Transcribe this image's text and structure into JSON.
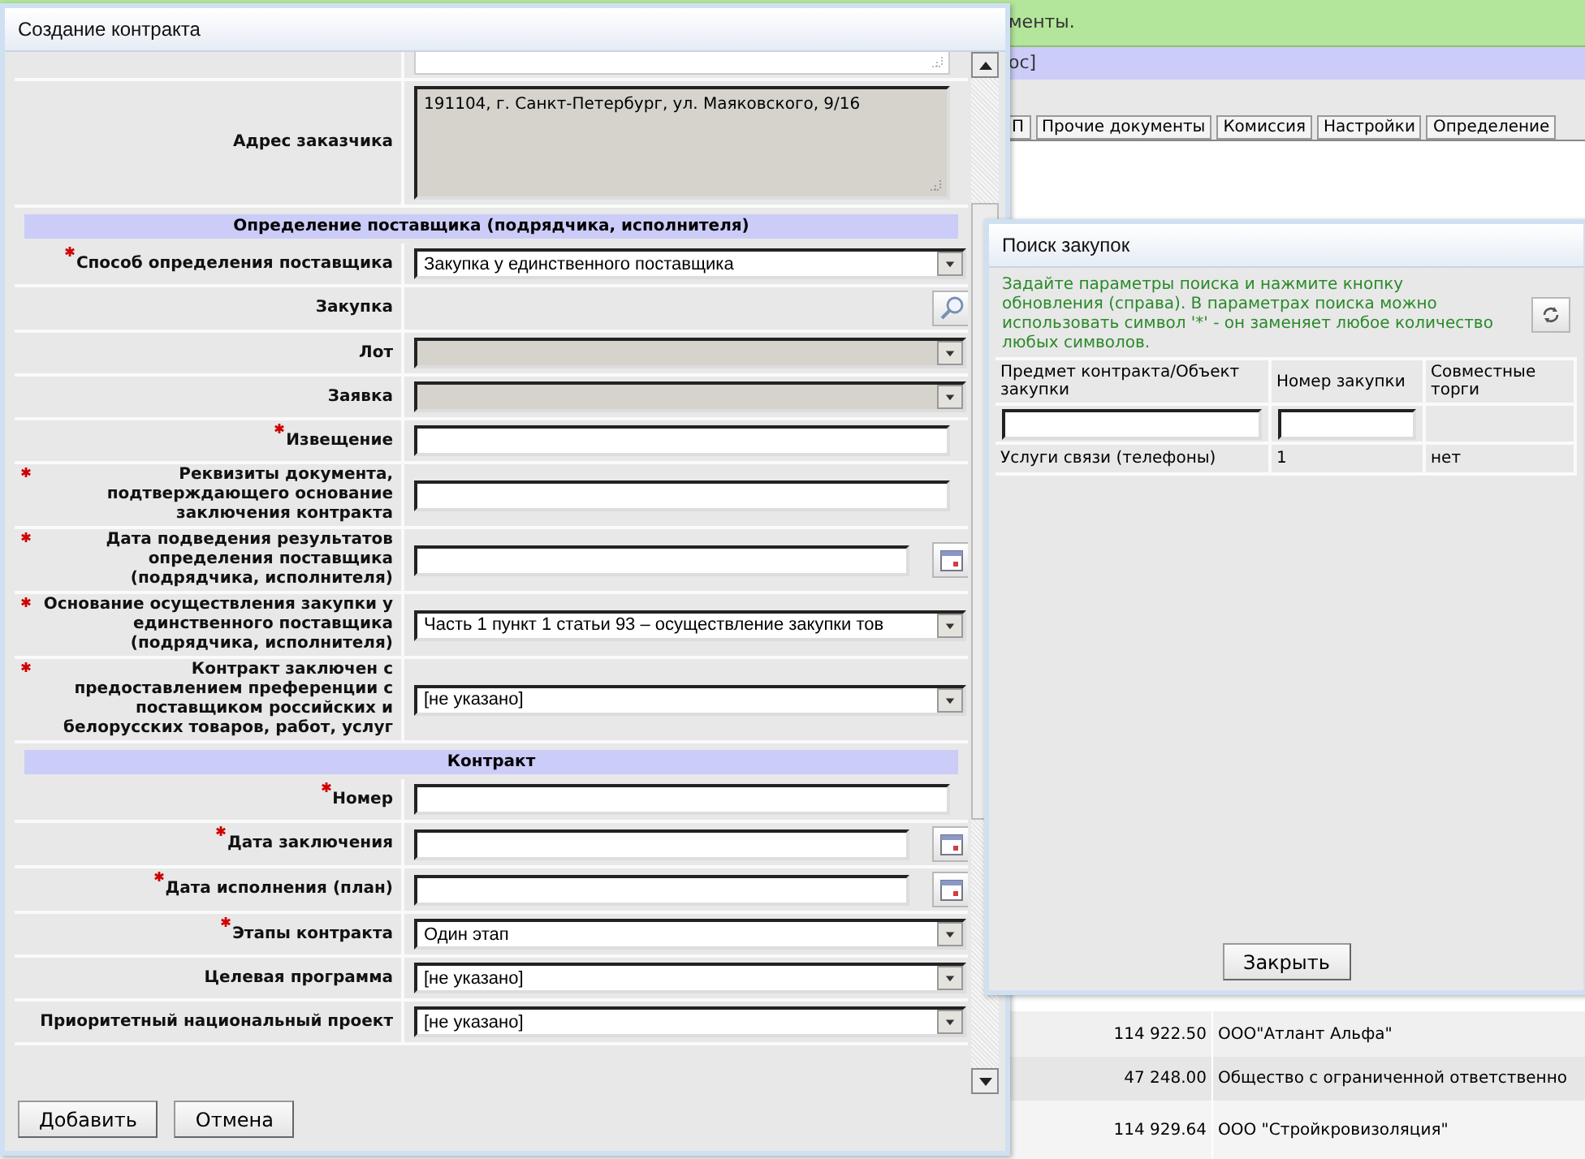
{
  "background_page": {
    "notice": "менты.",
    "breadcrumb": "ос]",
    "tabs": [
      "П",
      "Прочие документы",
      "Комиссия",
      "Настройки",
      "Определение"
    ],
    "rows": [
      {
        "amount": "114 922.50",
        "supplier": "ООО\"Атлант Альфа\""
      },
      {
        "amount": "47 248.00",
        "supplier": "Общество с ограниченной ответственно"
      },
      {
        "amount": "114 929.64",
        "supplier": "ООО \"Стройкровизоляция\""
      }
    ]
  },
  "contract_dialog": {
    "title": "Создание контракта",
    "fields": [
      {
        "kind": "textarea_tail"
      },
      {
        "kind": "textarea",
        "label": "Адрес заказчика",
        "required": false,
        "value": "191104, г. Санкт-Петербург, ул. Маяковского, 9/16"
      },
      {
        "kind": "section",
        "label": "Определение поставщика (подрядчика, исполнителя)"
      },
      {
        "kind": "select",
        "label": "Способ определения поставщика",
        "required": true,
        "disabled": false,
        "value": "Закупка у единственного поставщика"
      },
      {
        "kind": "lookup",
        "label": "Закупка",
        "required": false
      },
      {
        "kind": "select",
        "label": "Лот",
        "required": false,
        "disabled": true
      },
      {
        "kind": "select",
        "label": "Заявка",
        "required": false,
        "disabled": true
      },
      {
        "kind": "input",
        "label": "Извещение",
        "required": true
      },
      {
        "kind": "input",
        "label": "Реквизиты документа, подтверждающего основание заключения контракта",
        "required": true
      },
      {
        "kind": "date",
        "label": "Дата подведения результатов определения поставщика (подрядчика, исполнителя)",
        "required": true
      },
      {
        "kind": "select",
        "label": "Основание осуществления закупки у единственного поставщика (подрядчика, исполнителя)",
        "required": true,
        "disabled": false,
        "value": "Часть 1 пункт 1 статьи 93 – осуществление закупки тов"
      },
      {
        "kind": "select",
        "label": "Контракт заключен с предоставлением преференции с поставщиком российских и белорусских товаров, работ, услуг",
        "required": true,
        "disabled": false,
        "value": "[не указано]"
      },
      {
        "kind": "section",
        "label": "Контракт"
      },
      {
        "kind": "input",
        "label": "Номер",
        "required": true
      },
      {
        "kind": "date",
        "label": "Дата заключения",
        "required": true
      },
      {
        "kind": "date",
        "label": "Дата исполнения (план)",
        "required": true
      },
      {
        "kind": "select",
        "label": "Этапы контракта",
        "required": true,
        "disabled": false,
        "value": "Один этап"
      },
      {
        "kind": "select",
        "label": "Целевая программа",
        "required": false,
        "disabled": false,
        "value": "[не указано]"
      },
      {
        "kind": "select",
        "label": "Приоритетный национальный проект",
        "required": false,
        "disabled": false,
        "value": "[не указано]"
      }
    ],
    "buttons": [
      "Добавить",
      "Отмена"
    ]
  },
  "search_dialog": {
    "title": "Поиск закупок",
    "hint": "Задайте параметры поиска и нажмите кнопку обновления (справа). В параметрах поиска можно использовать символ '*' - он заменяет любое количество любых символов.",
    "columns": [
      {
        "label": "Предмет контракта/Объект закупки",
        "filter": true
      },
      {
        "label": "Номер закупки",
        "filter": true
      },
      {
        "label": "Совместные торги",
        "filter": false
      }
    ],
    "rows": [
      [
        "Услуги связи (телефоны)",
        "1",
        "нет"
      ]
    ],
    "close_button": "Закрыть"
  }
}
